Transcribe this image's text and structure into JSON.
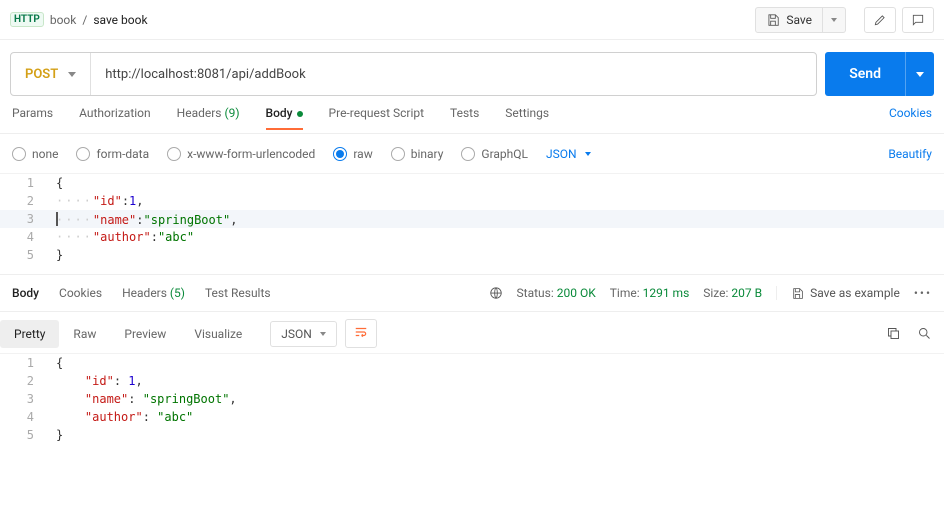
{
  "header": {
    "http_badge": "HTTP",
    "breadcrumb_parent": "book",
    "breadcrumb_current": "save book",
    "save_label": "Save"
  },
  "url_row": {
    "method": "POST",
    "url": "http://localhost:8081/api/addBook",
    "send_label": "Send"
  },
  "req_tabs": {
    "params": "Params",
    "auth": "Authorization",
    "headers_label": "Headers",
    "headers_count": "(9)",
    "body": "Body",
    "prerequest": "Pre-request Script",
    "tests": "Tests",
    "settings": "Settings",
    "cookies_link": "Cookies"
  },
  "body_types": {
    "none": "none",
    "formdata": "form-data",
    "xurl": "x-www-form-urlencoded",
    "raw": "raw",
    "binary": "binary",
    "graphql": "GraphQL",
    "content_dd": "JSON",
    "beautify": "Beautify"
  },
  "req_editor": {
    "lines": [
      "1",
      "2",
      "3",
      "4",
      "5"
    ]
  },
  "req_json_tokens": {
    "k_id": "\"id\"",
    "v_id": "1",
    "k_name": "\"name\"",
    "v_name": "\"springBoot\"",
    "k_author": "\"author\"",
    "v_author": "\"abc\""
  },
  "resp_tabs": {
    "body": "Body",
    "cookies": "Cookies",
    "headers_label": "Headers",
    "headers_count": "(5)",
    "tests": "Test Results"
  },
  "status": {
    "status_label": "Status:",
    "status_value": "200 OK",
    "time_label": "Time:",
    "time_value": "1291 ms",
    "size_label": "Size:",
    "size_value": "207 B",
    "save_example": "Save as example"
  },
  "view_tabs": {
    "pretty": "Pretty",
    "raw": "Raw",
    "preview": "Preview",
    "visualize": "Visualize",
    "json_dd": "JSON"
  },
  "resp_editor": {
    "lines": [
      "1",
      "2",
      "3",
      "4",
      "5"
    ]
  },
  "resp_json_tokens": {
    "k_id": "\"id\"",
    "v_id": "1",
    "k_name": "\"name\"",
    "v_name": "\"springBoot\"",
    "k_author": "\"author\"",
    "v_author": "\"abc\""
  }
}
